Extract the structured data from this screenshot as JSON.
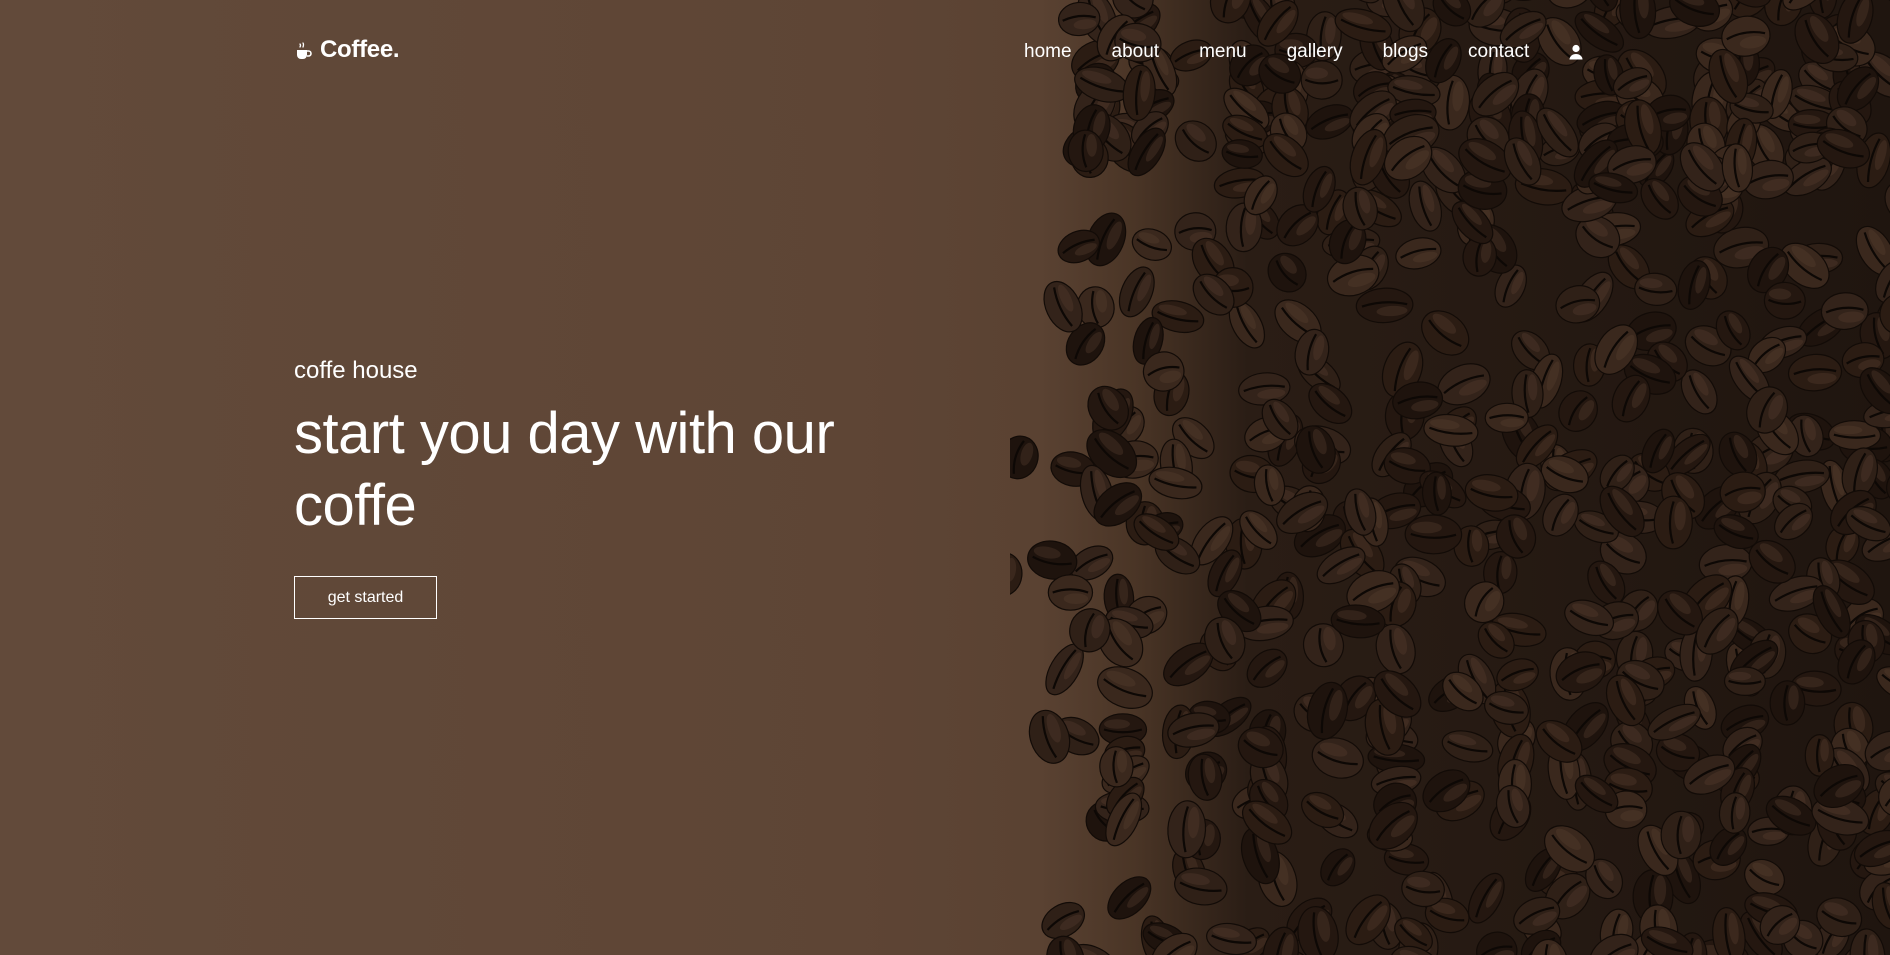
{
  "brand": {
    "name": "Coffee.",
    "icon": "mug-hot-icon"
  },
  "nav": {
    "items": [
      {
        "label": "home"
      },
      {
        "label": "about"
      },
      {
        "label": "menu"
      },
      {
        "label": "gallery"
      },
      {
        "label": "blogs"
      },
      {
        "label": "contact"
      }
    ],
    "user_icon": "user-icon"
  },
  "hero": {
    "eyebrow": "coffe house",
    "headline": "start you day with our coffe",
    "cta_label": "get started"
  },
  "colors": {
    "background": "#5e4636",
    "text": "#ffffff",
    "beans": "#2a1b12"
  }
}
